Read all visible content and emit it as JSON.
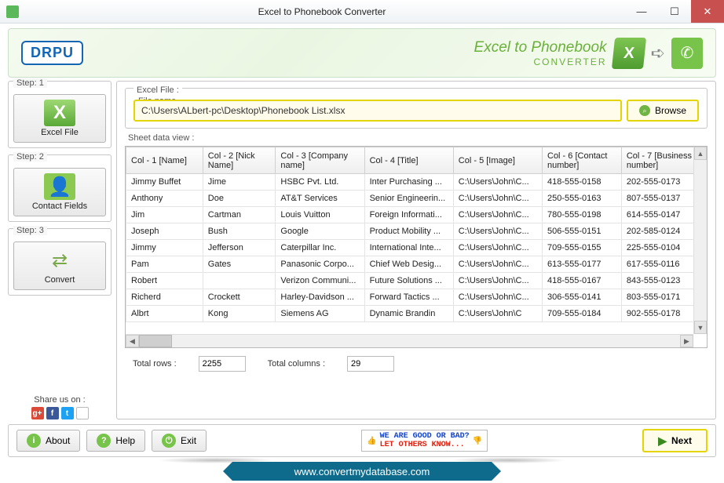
{
  "window": {
    "title": "Excel to Phonebook Converter"
  },
  "banner": {
    "logo": "DRPU",
    "line1": "Excel to Phonebook",
    "line2": "CONVERTER"
  },
  "steps": {
    "s1": {
      "legend": "Step: 1",
      "label": "Excel File"
    },
    "s2": {
      "legend": "Step: 2",
      "label": "Contact Fields"
    },
    "s3": {
      "legend": "Step: 3",
      "label": "Convert"
    }
  },
  "share": {
    "label": "Share us on :"
  },
  "excelFile": {
    "group": "Excel File :",
    "fileNameLabel": "File name",
    "path": "C:\\Users\\ALbert-pc\\Desktop\\Phonebook List.xlsx",
    "browse": "Browse"
  },
  "sheet": {
    "label": "Sheet data view :",
    "columns": [
      "Col - 1 [Name]",
      "Col - 2 [Nick Name]",
      "Col - 3 [Company name]",
      "Col - 4 [Title]",
      "Col - 5 [Image]",
      "Col - 6 [Contact number]",
      "Col - 7 [Business number]"
    ],
    "rows": [
      [
        "Jimmy Buffet",
        "Jime",
        "HSBC Pvt. Ltd.",
        "Inter Purchasing ...",
        "C:\\Users\\John\\C...",
        "418-555-0158",
        "202-555-0173"
      ],
      [
        "Anthony",
        "Doe",
        "AT&T Services",
        "Senior Engineerin...",
        "C:\\Users\\John\\C...",
        "250-555-0163",
        "807-555-0137"
      ],
      [
        "Jim",
        "Cartman",
        "Louis Vuitton",
        "Foreign Informati...",
        "C:\\Users\\John\\C...",
        "780-555-0198",
        "614-555-0147"
      ],
      [
        "Joseph",
        "Bush",
        "Google",
        "Product Mobility ...",
        "C:\\Users\\John\\C...",
        "506-555-0151",
        "202-585-0124"
      ],
      [
        "Jimmy",
        "Jefferson",
        "Caterpillar Inc.",
        "International Inte...",
        "C:\\Users\\John\\C...",
        "709-555-0155",
        "225-555-0104"
      ],
      [
        "Pam",
        "Gates",
        "Panasonic Corpo...",
        "Chief Web Desig...",
        "C:\\Users\\John\\C...",
        "613-555-0177",
        "617-555-0116"
      ],
      [
        "Robert",
        "",
        "Verizon Communi...",
        "Future Solutions ...",
        "C:\\Users\\John\\C...",
        "418-555-0167",
        "843-555-0123"
      ],
      [
        "Richerd",
        "Crockett",
        "Harley-Davidson ...",
        "Forward Tactics ...",
        "C:\\Users\\John\\C...",
        "306-555-0141",
        "803-555-0171"
      ],
      [
        "Albrt",
        "Kong",
        "Siemens AG",
        "Dynamic Brandin",
        "C:\\Users\\John\\C",
        "709-555-0184",
        "902-555-0178"
      ]
    ]
  },
  "totals": {
    "rowsLabel": "Total rows :",
    "rows": "2255",
    "colsLabel": "Total columns :",
    "cols": "29"
  },
  "bottom": {
    "about": "About",
    "help": "Help",
    "exit": "Exit",
    "feedback1": "WE ARE GOOD OR BAD?",
    "feedback2": "LET OTHERS KNOW...",
    "next": "Next"
  },
  "footer": {
    "url": "www.convertmydatabase.com"
  }
}
